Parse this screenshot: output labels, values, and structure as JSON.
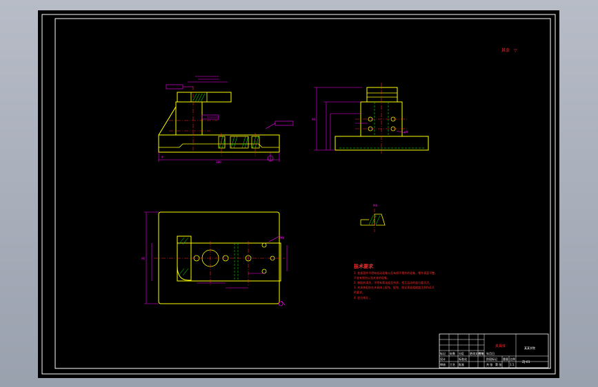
{
  "sheet": {
    "corner_note": "其余 ",
    "technical_requirements": {
      "heading": "技术要求",
      "lines": [
        "1. 各紧固件不得有松动现象以及有损坏零件的现象，零件表面平整，",
        "不准有划伤以及夹紧的现象。",
        "2. 装配前清洗，不得有氧化皮及杂质，相互运动的部分要灵活。",
        "3. 夹具装配前在夹具体上配钻、配铰，保证表面粗糙度达到Ra1.6",
        "的要求。",
        "4. 定位销孔       。"
      ]
    },
    "title_block": {
      "drawing_name": "夹具体",
      "company": "某某学院",
      "drawing_number": "ZJ-01",
      "cells": [
        "标记",
        "处数",
        "分区",
        "更改文件号",
        "签名",
        "年月日",
        "设计",
        "标准化",
        "阶段标记",
        "重量",
        "比例",
        "审核",
        "工艺",
        "批准",
        "共 张",
        "第 张",
        "1:1"
      ]
    },
    "colors": {
      "background": "#000000",
      "outline": "#ffff00",
      "dimension": "#ff00ff",
      "centerline": "#ff2a2a",
      "hidden": "#00c800",
      "sheet_border": "#ffffff",
      "frame": "#9aa1ae"
    }
  }
}
